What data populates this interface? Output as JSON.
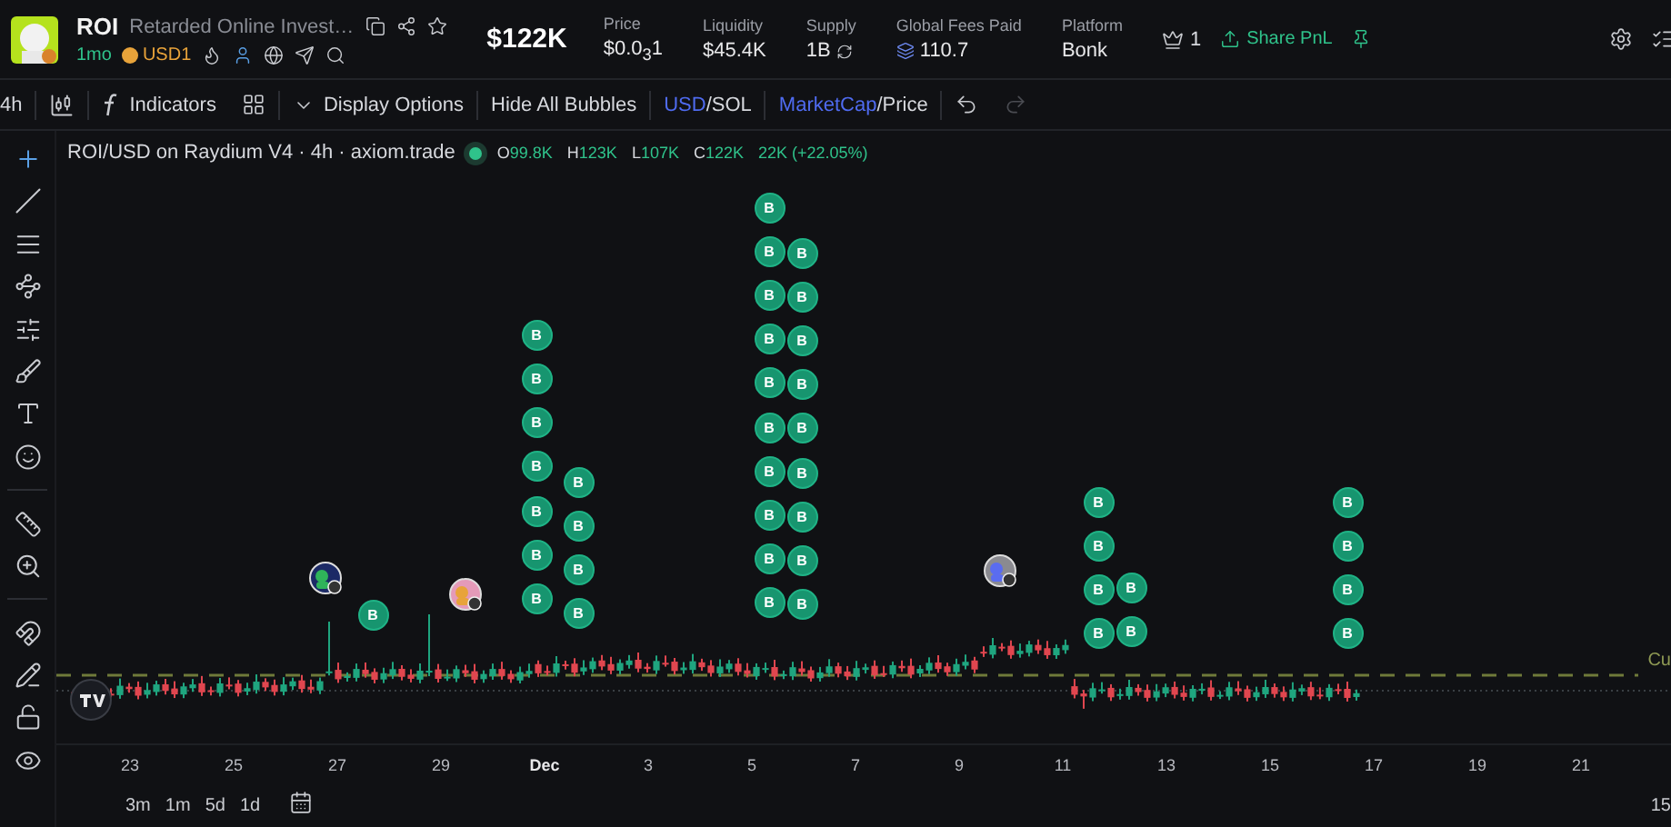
{
  "token": {
    "ticker": "ROI",
    "name": "Retarded Online Invest…",
    "age": "1mo",
    "quote_badge": "USD1"
  },
  "market_cap": "$122K",
  "stats": [
    {
      "label": "Price",
      "value": "$0.0$_{3}$1",
      "kind": "plain"
    },
    {
      "label": "Liquidity",
      "value": "$45.4K",
      "kind": "plain"
    },
    {
      "label": "Supply",
      "value": "1B",
      "kind": "supply"
    },
    {
      "label": "Global Fees Paid",
      "value": "110.7",
      "kind": "fees"
    },
    {
      "label": "Platform",
      "value": "Bonk",
      "kind": "plain"
    }
  ],
  "holders_count": "1",
  "share_button": "Share PnL",
  "toolbar": {
    "interval": "4h",
    "indicators": "Indicators",
    "display_options": "Display Options",
    "hide_bubbles": "Hide All Bubbles",
    "currency": {
      "separator": "/",
      "options": [
        {
          "label": "USD",
          "selected": true
        },
        {
          "label": "SOL",
          "selected": false
        }
      ]
    },
    "metric": {
      "separator": "/",
      "options": [
        {
          "label": "MarketCap",
          "selected": true
        },
        {
          "label": "Price",
          "selected": false
        }
      ]
    }
  },
  "legend": {
    "title": "ROI/USD on Raydium V4 · 4h · axiom.trade",
    "ohlc": [
      {
        "key": "O",
        "value": "99.8K"
      },
      {
        "key": "H",
        "value": "123K"
      },
      {
        "key": "L",
        "value": "107K"
      },
      {
        "key": "C",
        "value": "122K"
      }
    ],
    "change": "22K (+22.05%)"
  },
  "bubble_columns": [
    {
      "labels": [
        "B"
      ]
    },
    {
      "labels": [
        "B",
        "B",
        "B",
        "B",
        "B",
        "B",
        "B"
      ]
    },
    {
      "labels": [
        "B",
        "B",
        "B",
        "B"
      ]
    },
    {
      "labels": [
        "B",
        "B",
        "B",
        "B",
        "B",
        "B",
        "B",
        "B",
        "B",
        "B"
      ]
    },
    {
      "labels": [
        "B",
        "B",
        "B",
        "B",
        "B",
        "B",
        "B",
        "B",
        "B"
      ]
    },
    {
      "labels": [
        "B",
        "B",
        "B",
        "B"
      ]
    },
    {
      "labels": [
        "B",
        "B"
      ]
    },
    {
      "labels": [
        "B",
        "B",
        "B",
        "B"
      ]
    }
  ],
  "price_line_label": "Cu",
  "time_axis": [
    "23",
    "25",
    "27",
    "29",
    "Dec",
    "3",
    "5",
    "7",
    "9",
    "11",
    "13",
    "15",
    "17",
    "19",
    "21"
  ],
  "ranges": [
    "3m",
    "1m",
    "5d",
    "1d"
  ],
  "corner_label": "15"
}
